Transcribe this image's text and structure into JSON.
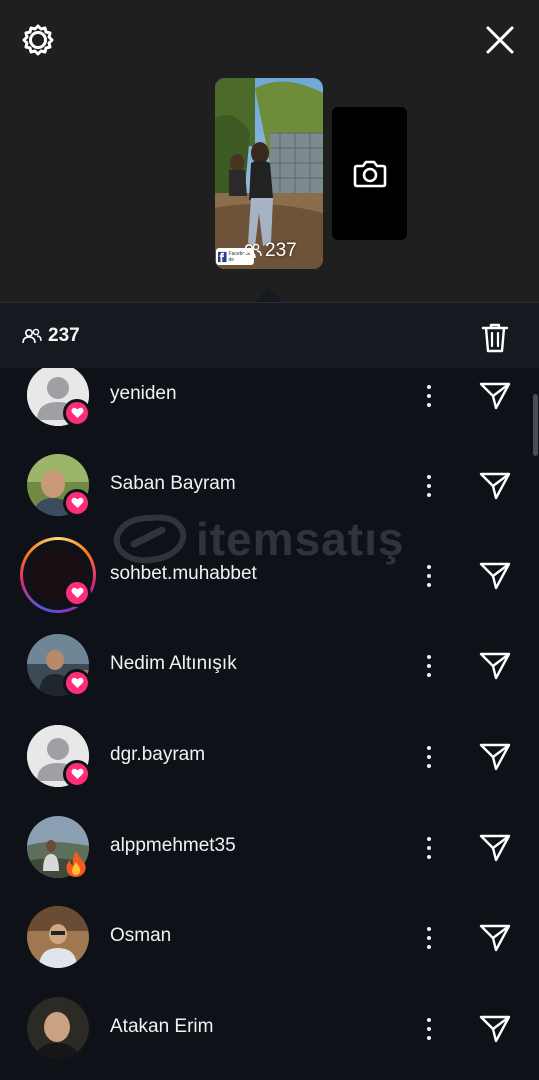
{
  "header": {
    "settings_icon": "gear-icon",
    "close_icon": "close-icon"
  },
  "story": {
    "views": "237",
    "sticker_text": "Facebook' de"
  },
  "viewers_bar": {
    "count": "237",
    "delete_icon": "trash-icon"
  },
  "viewers": [
    {
      "username": "yeniden",
      "badge": "heart",
      "avatar": "default"
    },
    {
      "username": "Saban Bayram",
      "badge": "heart",
      "avatar": "photo"
    },
    {
      "username": "sohbet.muhabbet",
      "badge": "heart",
      "avatar": "story-ring"
    },
    {
      "username": "Nedim Altınışık",
      "badge": "heart",
      "avatar": "photo"
    },
    {
      "username": "dgr.bayram",
      "badge": "heart",
      "avatar": "default"
    },
    {
      "username": "alppmehmet35",
      "badge": "fire",
      "avatar": "photo"
    },
    {
      "username": "Osman",
      "badge": "none",
      "avatar": "photo"
    },
    {
      "username": "Atakan Erim",
      "badge": "none",
      "avatar": "photo"
    }
  ],
  "watermark": "itemsatış",
  "colors": {
    "heart": "#ff2d78",
    "background": "#0e1117",
    "top_panel": "#1f1f1f"
  }
}
